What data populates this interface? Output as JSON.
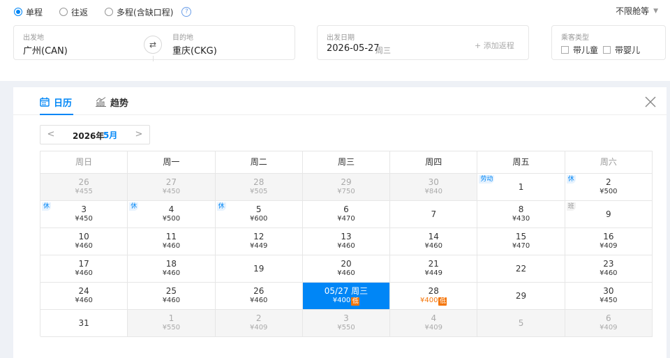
{
  "trip_types": [
    {
      "label": "单程",
      "checked": true
    },
    {
      "label": "往返",
      "checked": false
    },
    {
      "label": "多程(含缺口程)",
      "checked": false
    }
  ],
  "help_icon": "?",
  "cabin_label": "不限舱等",
  "from": {
    "label": "出发地",
    "value": "广州(CAN)"
  },
  "to": {
    "label": "目的地",
    "value": "重庆(CKG)"
  },
  "swap_icon": "⇄",
  "depart": {
    "label": "出发日期",
    "value": "2026-05-27",
    "weekday": "周三",
    "add_return": "+ 添加返程"
  },
  "passenger": {
    "label": "乘客类型",
    "child": "带儿童",
    "infant": "带婴儿"
  },
  "tabs": {
    "calendar": "日历",
    "trend": "趋势"
  },
  "month": {
    "prev": "<",
    "year": "2026年",
    "month": "5月",
    "next": ">"
  },
  "weekdays": [
    "周日",
    "周一",
    "周二",
    "周三",
    "周四",
    "周五",
    "周六"
  ],
  "colors": {
    "accent": "#0086f6",
    "low": "#f5760a"
  },
  "low_tag": "低",
  "calendar": [
    [
      {
        "d": "26",
        "p": "¥455",
        "other": true
      },
      {
        "d": "27",
        "p": "¥450",
        "other": true
      },
      {
        "d": "28",
        "p": "¥505",
        "other": true
      },
      {
        "d": "29",
        "p": "¥750",
        "other": true
      },
      {
        "d": "30",
        "p": "¥840",
        "other": true
      },
      {
        "d": "1",
        "p": "",
        "tag": "劳动"
      },
      {
        "d": "2",
        "p": "¥500",
        "tag": "休"
      }
    ],
    [
      {
        "d": "3",
        "p": "¥450",
        "tag": "休"
      },
      {
        "d": "4",
        "p": "¥500",
        "tag": "休"
      },
      {
        "d": "5",
        "p": "¥600",
        "tag": "休"
      },
      {
        "d": "6",
        "p": "¥470"
      },
      {
        "d": "7",
        "p": ""
      },
      {
        "d": "8",
        "p": "¥430"
      },
      {
        "d": "9",
        "p": "",
        "tag": "班",
        "ban": true
      }
    ],
    [
      {
        "d": "10",
        "p": "¥460"
      },
      {
        "d": "11",
        "p": "¥460"
      },
      {
        "d": "12",
        "p": "¥449"
      },
      {
        "d": "13",
        "p": "¥460"
      },
      {
        "d": "14",
        "p": "¥460"
      },
      {
        "d": "15",
        "p": "¥470"
      },
      {
        "d": "16",
        "p": "¥409"
      }
    ],
    [
      {
        "d": "17",
        "p": "¥460"
      },
      {
        "d": "18",
        "p": "¥460"
      },
      {
        "d": "19",
        "p": ""
      },
      {
        "d": "20",
        "p": "¥460"
      },
      {
        "d": "21",
        "p": "¥449"
      },
      {
        "d": "22",
        "p": ""
      },
      {
        "d": "23",
        "p": "¥460"
      }
    ],
    [
      {
        "d": "24",
        "p": "¥460"
      },
      {
        "d": "25",
        "p": "¥460"
      },
      {
        "d": "26",
        "p": "¥460"
      },
      {
        "d": "05/27 周三",
        "p": "¥400",
        "selected": true,
        "low": true
      },
      {
        "d": "28",
        "p": "¥400",
        "low": true
      },
      {
        "d": "29",
        "p": ""
      },
      {
        "d": "30",
        "p": "¥450"
      }
    ],
    [
      {
        "d": "31",
        "p": ""
      },
      {
        "d": "1",
        "p": "¥550",
        "other": true
      },
      {
        "d": "2",
        "p": "¥409",
        "other": true
      },
      {
        "d": "3",
        "p": "¥550",
        "other": true
      },
      {
        "d": "4",
        "p": "¥409",
        "other": true
      },
      {
        "d": "5",
        "p": "",
        "other": true
      },
      {
        "d": "6",
        "p": "¥409",
        "other": true
      }
    ]
  ]
}
